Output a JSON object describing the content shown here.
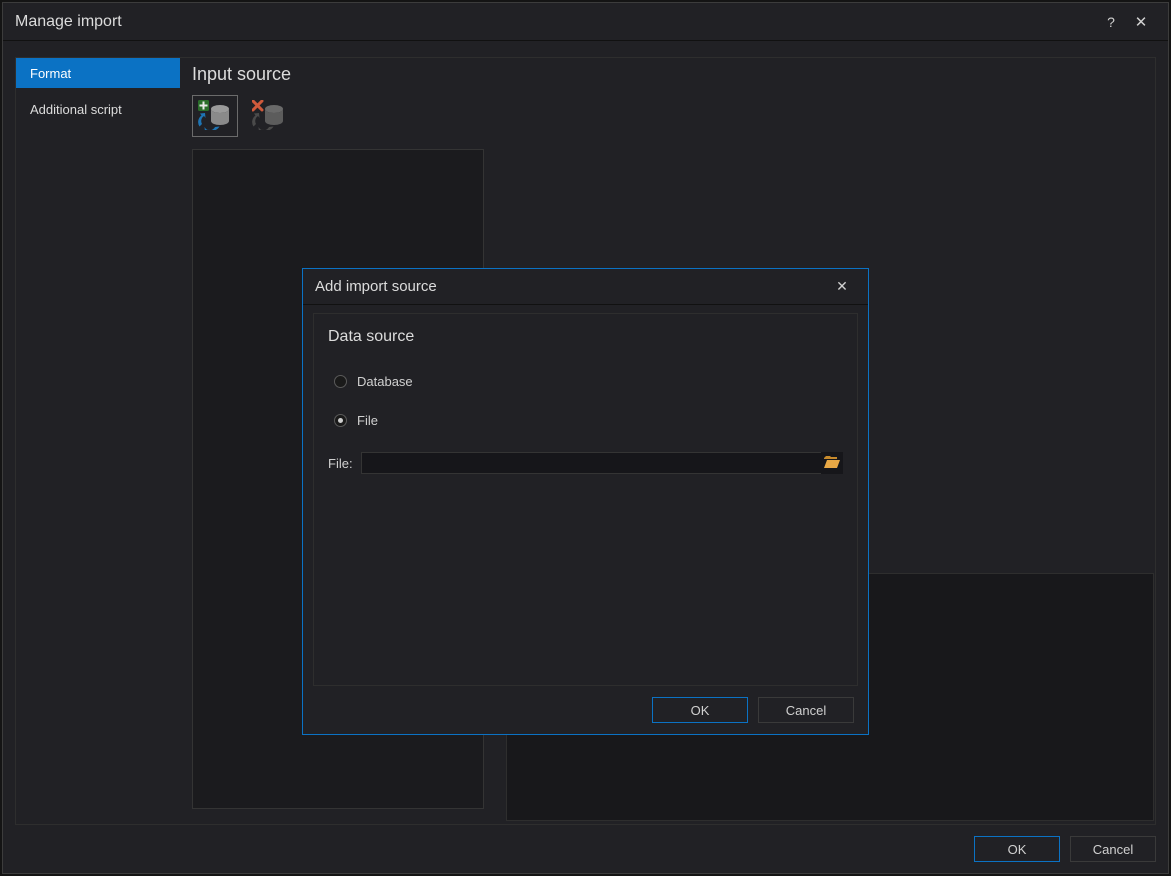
{
  "outer": {
    "title": "Manage import",
    "sidebar": {
      "items": [
        {
          "label": "Format",
          "active": true
        },
        {
          "label": "Additional script",
          "active": false
        }
      ]
    },
    "section_title": "Input source",
    "toolbar": {
      "add_icon": "add-source-icon",
      "remove_icon": "remove-source-icon"
    },
    "footer": {
      "ok_label": "OK",
      "cancel_label": "Cancel"
    }
  },
  "modal": {
    "title": "Add import source",
    "group_title": "Data source",
    "options": {
      "database_label": "Database",
      "file_label": "File",
      "selected": "file"
    },
    "file_field": {
      "label": "File:",
      "value": ""
    },
    "footer": {
      "ok_label": "OK",
      "cancel_label": "Cancel"
    }
  }
}
